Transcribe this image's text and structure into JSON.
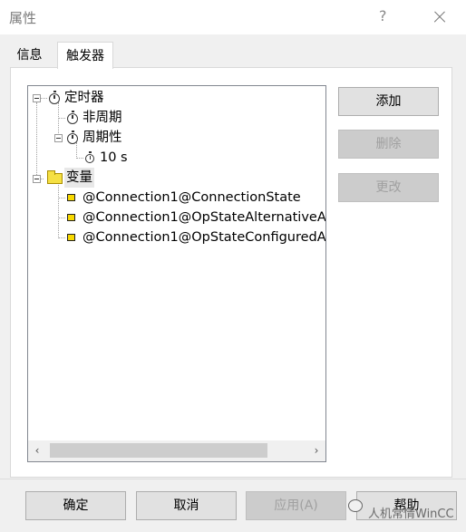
{
  "window": {
    "title": "属性",
    "help_glyph": "?",
    "close_glyph": "×"
  },
  "tabs": [
    {
      "label": "信息",
      "active": false
    },
    {
      "label": "触发器",
      "active": true
    }
  ],
  "tree": {
    "nodes": [
      {
        "label": "定时器",
        "icon": "stopwatch-icon",
        "expanded": true
      },
      {
        "label": "非周期",
        "icon": "stopwatch-icon"
      },
      {
        "label": "周期性",
        "icon": "stopwatch-icon",
        "expanded": true
      },
      {
        "label": "10 s",
        "icon": "stopwatch-icon"
      },
      {
        "label": "变量",
        "icon": "folder-icon",
        "expanded": true,
        "selected": true
      },
      {
        "label": "@Connection1@ConnectionState",
        "icon": "tag-icon"
      },
      {
        "label": "@Connection1@OpStateAlternativeA",
        "icon": "tag-icon"
      },
      {
        "label": "@Connection1@OpStateConfiguredA",
        "icon": "tag-icon"
      }
    ],
    "scroll_left_glyph": "‹",
    "scroll_right_glyph": "›"
  },
  "side_buttons": {
    "add": {
      "label": "添加",
      "enabled": true
    },
    "delete": {
      "label": "删除",
      "enabled": false
    },
    "change": {
      "label": "更改",
      "enabled": false
    }
  },
  "footer_buttons": {
    "ok": {
      "label": "确定",
      "enabled": true
    },
    "cancel": {
      "label": "取消",
      "enabled": true
    },
    "apply": {
      "label": "应用(A)",
      "enabled": false
    },
    "help": {
      "label": "帮助",
      "enabled": true
    }
  },
  "watermark": {
    "text": "人机常情WinCC"
  },
  "colors": {
    "background": "#f0f0f0",
    "folder_yellow": "#f5e043",
    "tag_yellow": "#f7d800",
    "disabled_text": "#a0a0a0"
  }
}
